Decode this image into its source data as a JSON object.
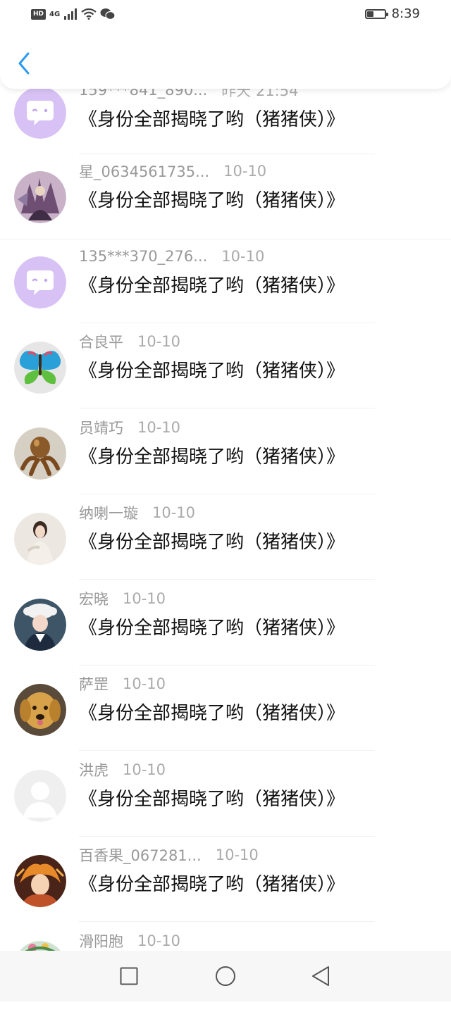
{
  "status_bar": {
    "hd": "HD",
    "network": "4G",
    "time": "8:39"
  },
  "header": {
    "back_icon": "chevron-left-icon",
    "accent": "#2b9bf0"
  },
  "messages": [
    {
      "name": "159***841_890...",
      "time": "昨天 21:54",
      "text": "《身份全部揭晓了哟（猪猪侠）》",
      "avatar": "default-chat-avatar"
    },
    {
      "name": "星_0634561735...",
      "time": "10-10",
      "text": "《身份全部揭晓了哟（猪猪侠）》",
      "avatar": "illustration-avatar"
    },
    {
      "name": "135***370_276...",
      "time": "10-10",
      "text": "《身份全部揭晓了哟（猪猪侠）》",
      "avatar": "default-chat-avatar"
    },
    {
      "name": "合良平",
      "time": "10-10",
      "text": "《身份全部揭晓了哟（猪猪侠）》",
      "avatar": "butterfly-avatar"
    },
    {
      "name": "员靖巧",
      "time": "10-10",
      "text": "《身份全部揭晓了哟（猪猪侠）》",
      "avatar": "octopus-statue-avatar"
    },
    {
      "name": "纳喇一璇",
      "time": "10-10",
      "text": "《身份全部揭晓了哟（猪猪侠）》",
      "avatar": "woman-photo-avatar"
    },
    {
      "name": "宏晓",
      "time": "10-10",
      "text": "《身份全部揭晓了哟（猪猪侠）》",
      "avatar": "child-photo-avatar"
    },
    {
      "name": "萨罡",
      "time": "10-10",
      "text": "《身份全部揭晓了哟（猪猪侠）》",
      "avatar": "puppy-avatar"
    },
    {
      "name": "洪虎",
      "time": "10-10",
      "text": "《身份全部揭晓了哟（猪猪侠）》",
      "avatar": "blank-user-avatar"
    },
    {
      "name": "百香果_067281...",
      "time": "10-10",
      "text": "《身份全部揭晓了哟（猪猪侠）》",
      "avatar": "anime-avatar"
    },
    {
      "name": "滑阳胞",
      "time": "10-10",
      "text": "",
      "avatar": "flowers-avatar"
    }
  ],
  "navbar": {
    "recents_icon": "square-icon",
    "home_icon": "circle-icon",
    "back_icon": "triangle-back-icon"
  }
}
